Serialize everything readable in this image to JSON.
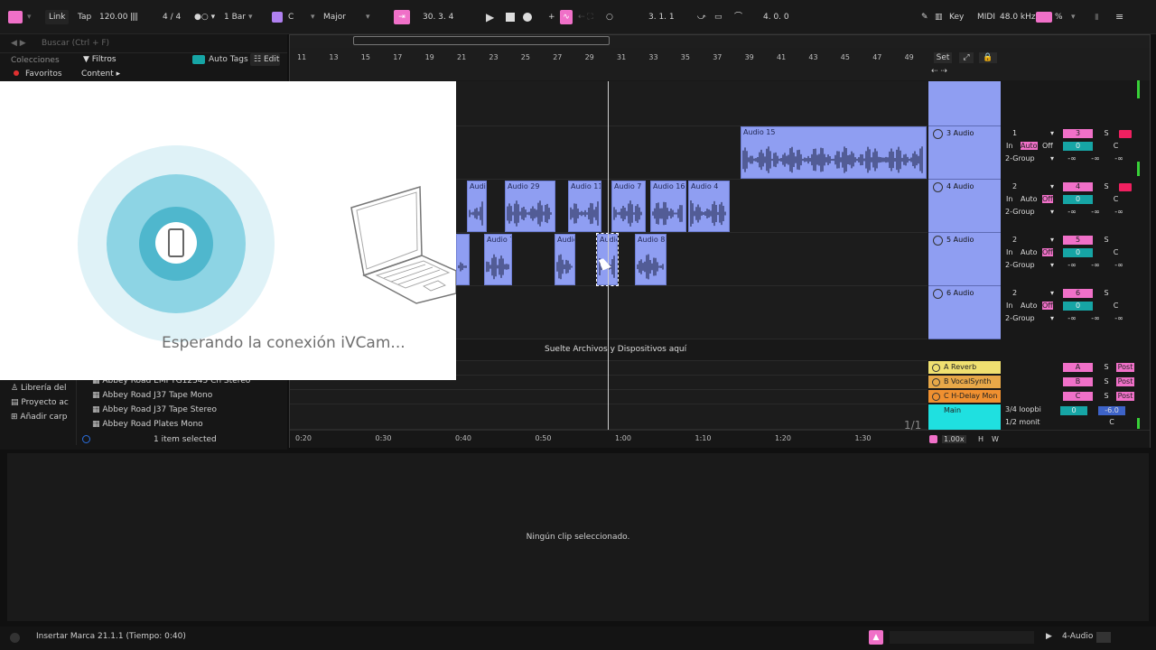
{
  "topbar": {
    "link": "Link",
    "tap": "Tap",
    "tempo": "120.00",
    "signature": "4 / 4",
    "quantize": "1 Bar",
    "key": "C",
    "scale": "Major",
    "position": "30.  3.  4",
    "loop_start": "3.  1.  1",
    "loop_length": "4.  0.  0",
    "key_label": "Key",
    "midi_label": "MIDI",
    "sample_rate": "48.0 kHz",
    "cpu_suffix": "%"
  },
  "browser": {
    "search_placeholder": "Buscar (Ctrl + F)",
    "collections_title": "Colecciones",
    "favorites": "Favoritos",
    "filters": "Filtros",
    "auto_tags": "Auto Tags",
    "edit": "Edit",
    "content": "Content ▸",
    "places": [
      "Librería del",
      "Proyecto ac",
      "Añadir carp"
    ],
    "items": [
      "Abbey Road EMI TG12345 Ch Stereo",
      "Abbey Road J37 Tape Mono",
      "Abbey Road J37 Tape Stereo",
      "Abbey Road Plates Mono"
    ],
    "selection_status": "1 item selected"
  },
  "arrangement": {
    "bar_numbers": [
      "11",
      "13",
      "15",
      "17",
      "19",
      "21",
      "23",
      "25",
      "27",
      "29",
      "31",
      "33",
      "35",
      "37",
      "39",
      "41",
      "43",
      "45",
      "47",
      "49"
    ],
    "set_label": "Set",
    "drop_hint": "Suelte Archivos y Dispositivos aquí",
    "time_labels": [
      "0:20",
      "0:30",
      "0:40",
      "0:50",
      "1:00",
      "1:10",
      "1:20",
      "1:30"
    ],
    "page_indicator": "1/1",
    "zoom": "1.00x",
    "h": "H",
    "w": "W",
    "clips": [
      {
        "name": "Audio 15"
      },
      {
        "name": "Audio"
      },
      {
        "name": "Audio 29"
      },
      {
        "name": "Audio 11"
      },
      {
        "name": "Audio 7"
      },
      {
        "name": "Audio 16"
      },
      {
        "name": "Audio 4"
      },
      {
        "name": "Audio 7"
      },
      {
        "name": "Audio"
      },
      {
        "name": "Audio"
      },
      {
        "name": "Audio 8"
      }
    ],
    "tracks": [
      {
        "name": "3 Audio",
        "input": "1",
        "in": "In",
        "auto": "Auto",
        "off": "Off",
        "group": "2-Group",
        "num": "3",
        "solo": "S",
        "vol": "0",
        "pan": "C",
        "a": "-∞",
        "b": "-∞",
        "c": "-∞"
      },
      {
        "name": "4 Audio",
        "input": "2",
        "in": "In",
        "auto": "Auto",
        "off": "Off",
        "group": "2-Group",
        "num": "4",
        "solo": "S",
        "vol": "0",
        "pan": "C",
        "a": "-∞",
        "b": "-∞",
        "c": "-∞"
      },
      {
        "name": "5 Audio",
        "input": "2",
        "in": "In",
        "auto": "Auto",
        "off": "Off",
        "group": "2-Group",
        "num": "5",
        "solo": "S",
        "vol": "0",
        "pan": "C",
        "a": "-∞",
        "b": "-∞",
        "c": "-∞"
      },
      {
        "name": "6 Audio",
        "input": "2",
        "in": "In",
        "auto": "Auto",
        "off": "Off",
        "group": "2-Group",
        "num": "6",
        "solo": "S",
        "vol": "0",
        "pan": "C",
        "a": "-∞",
        "b": "-∞",
        "c": "-∞"
      }
    ],
    "returns": [
      {
        "name": "A Reverb",
        "letter": "A",
        "solo": "S",
        "post": "Post",
        "color": "#f0e070"
      },
      {
        "name": "B VocalSynth",
        "letter": "B",
        "solo": "S",
        "post": "Post",
        "color": "#e8a848"
      },
      {
        "name": "C H-Delay Mon",
        "letter": "C",
        "solo": "S",
        "post": "Post",
        "color": "#f09030"
      }
    ],
    "main": {
      "name": "Main",
      "routing_a": "3/4 loopbi",
      "routing_b": "1/2 monit",
      "vol": "0",
      "gain": "-6.0",
      "pan": "C"
    }
  },
  "detail": {
    "empty_message": "Ningún clip seleccionado."
  },
  "status": {
    "message": "Insertar Marca 21.1.1 (Tiempo: 0:40)",
    "track": "4-Audio"
  },
  "overlay": {
    "message": "Esperando la conexión iVCam..."
  }
}
